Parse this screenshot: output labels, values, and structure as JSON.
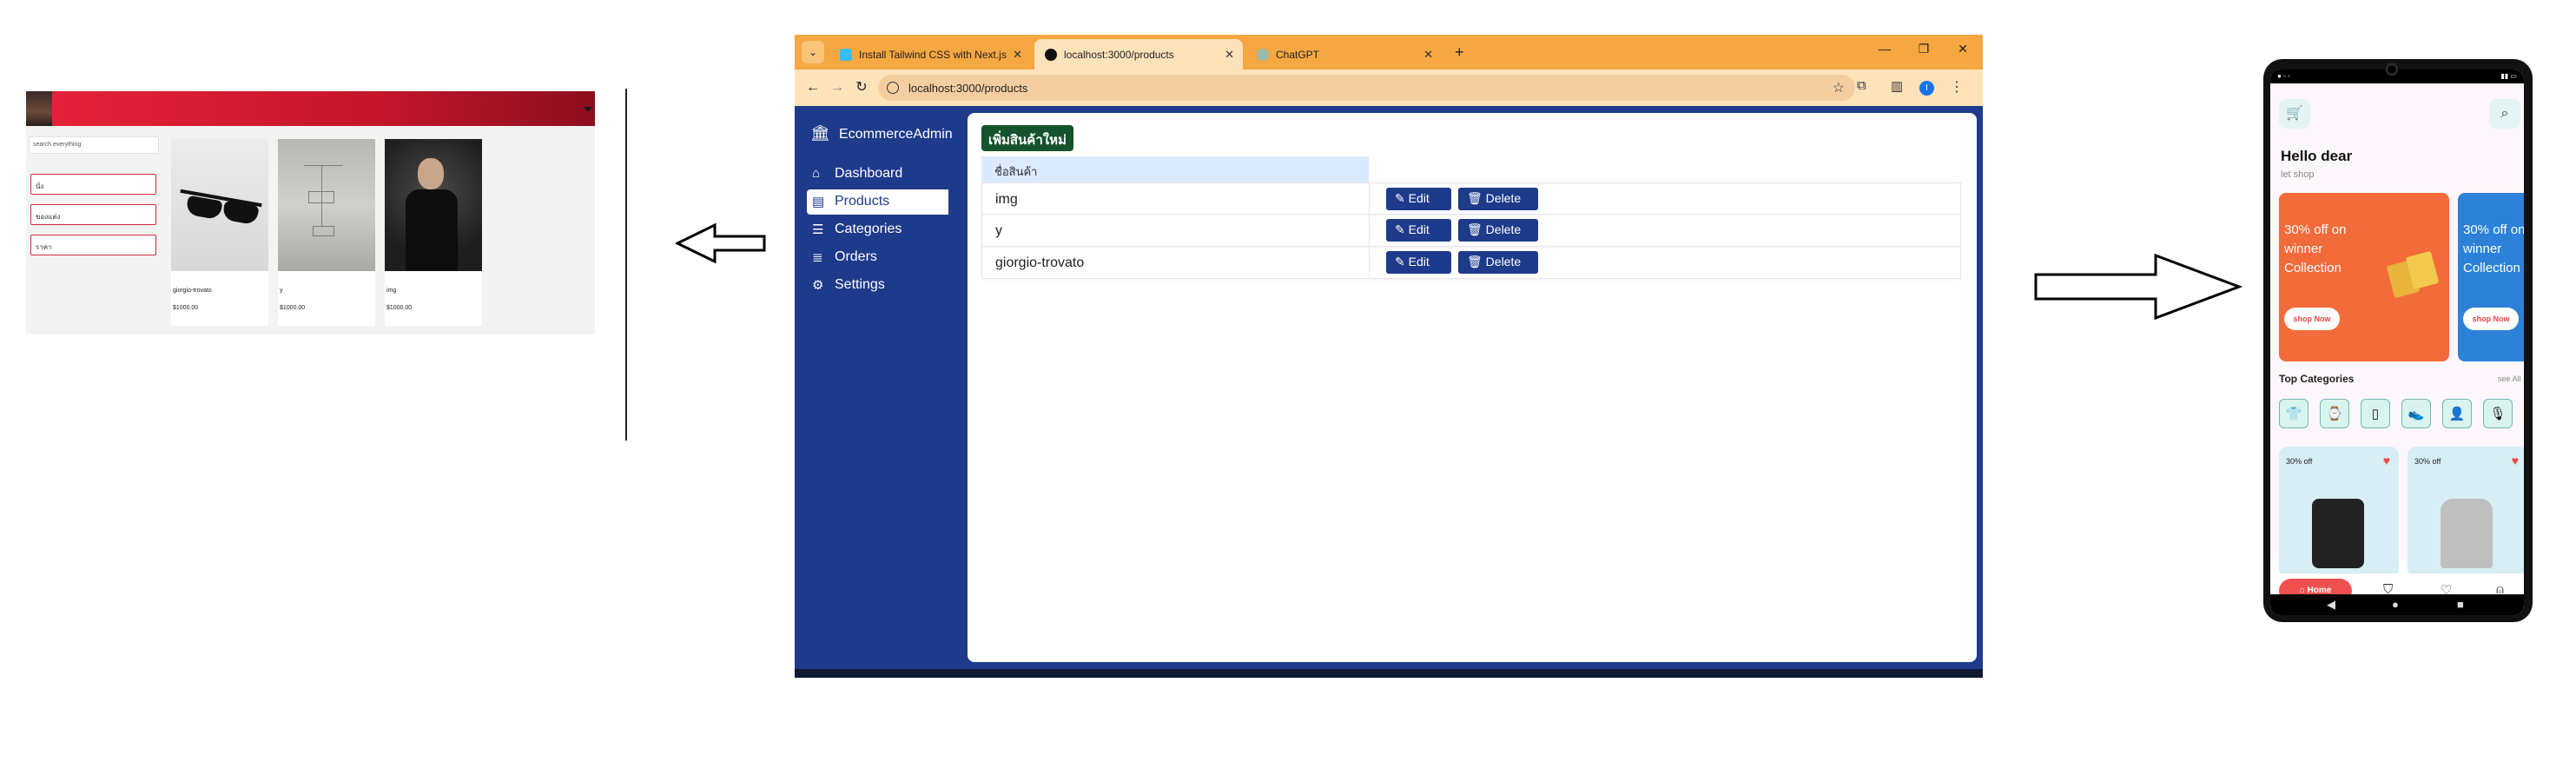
{
  "left_store": {
    "search_placeholder": "search everything",
    "categories": [
      "นั่ง",
      "ของแต่ง",
      "ราคา"
    ],
    "products": [
      {
        "name": "giorgio-trovato",
        "price": "$1000.00"
      },
      {
        "name": "y",
        "price": "$1000.00"
      },
      {
        "name": "img",
        "price": "$1000.00"
      }
    ]
  },
  "browser": {
    "tabs": [
      {
        "title": "Install Tailwind CSS with Next.js"
      },
      {
        "title": "localhost:3000/products"
      },
      {
        "title": "ChatGPT"
      }
    ],
    "new_tab": "+",
    "url": "localhost:3000/products",
    "profile_initial": "I"
  },
  "admin": {
    "brand": "EcommerceAdmin",
    "nav": [
      {
        "label": "Dashboard",
        "icon": "home-icon"
      },
      {
        "label": "Products",
        "icon": "archive-icon"
      },
      {
        "label": "Categories",
        "icon": "list-icon"
      },
      {
        "label": "Orders",
        "icon": "stack-icon"
      },
      {
        "label": "Settings",
        "icon": "gear-icon"
      }
    ],
    "add_product_label": "เพิ่มสินค้าใหม่",
    "table_header": "ชื่อสินค้า",
    "edit_label": "Edit",
    "delete_label": "Delete",
    "products": [
      "img",
      "y",
      "giorgio-trovato"
    ]
  },
  "phone": {
    "greeting": "Hello dear",
    "subgreeting": "let shop",
    "promo_text": "30% off on winner Collection",
    "shop_now": "shop Now",
    "top_categories": "Top Categories",
    "see_all": "see All",
    "category_icons": [
      "shirt-icon",
      "watch-icon",
      "phone-icon",
      "shoe-icon",
      "person-icon",
      "mic-icon"
    ],
    "product_cards": [
      {
        "discount": "30% off"
      },
      {
        "discount": "30% off"
      }
    ],
    "nav_home": "Home"
  },
  "colors": {
    "admin_bg": "#1e3a8a",
    "add_button": "#14532d",
    "browser_frame": "#f5a742",
    "banner_red": "#e8223b",
    "promo_orange": "#f26b3a",
    "promo_blue": "#2c82d8"
  }
}
